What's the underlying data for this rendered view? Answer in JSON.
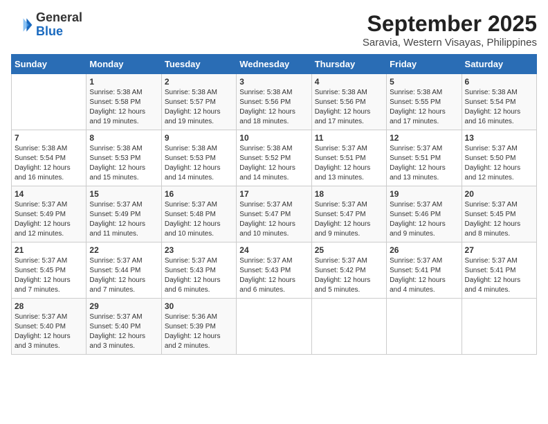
{
  "logo": {
    "general": "General",
    "blue": "Blue"
  },
  "header": {
    "month_year": "September 2025",
    "location": "Saravia, Western Visayas, Philippines"
  },
  "days_of_week": [
    "Sunday",
    "Monday",
    "Tuesday",
    "Wednesday",
    "Thursday",
    "Friday",
    "Saturday"
  ],
  "weeks": [
    [
      {
        "day": "",
        "info": ""
      },
      {
        "day": "1",
        "info": "Sunrise: 5:38 AM\nSunset: 5:58 PM\nDaylight: 12 hours\nand 19 minutes."
      },
      {
        "day": "2",
        "info": "Sunrise: 5:38 AM\nSunset: 5:57 PM\nDaylight: 12 hours\nand 19 minutes."
      },
      {
        "day": "3",
        "info": "Sunrise: 5:38 AM\nSunset: 5:56 PM\nDaylight: 12 hours\nand 18 minutes."
      },
      {
        "day": "4",
        "info": "Sunrise: 5:38 AM\nSunset: 5:56 PM\nDaylight: 12 hours\nand 17 minutes."
      },
      {
        "day": "5",
        "info": "Sunrise: 5:38 AM\nSunset: 5:55 PM\nDaylight: 12 hours\nand 17 minutes."
      },
      {
        "day": "6",
        "info": "Sunrise: 5:38 AM\nSunset: 5:54 PM\nDaylight: 12 hours\nand 16 minutes."
      }
    ],
    [
      {
        "day": "7",
        "info": "Sunrise: 5:38 AM\nSunset: 5:54 PM\nDaylight: 12 hours\nand 16 minutes."
      },
      {
        "day": "8",
        "info": "Sunrise: 5:38 AM\nSunset: 5:53 PM\nDaylight: 12 hours\nand 15 minutes."
      },
      {
        "day": "9",
        "info": "Sunrise: 5:38 AM\nSunset: 5:53 PM\nDaylight: 12 hours\nand 14 minutes."
      },
      {
        "day": "10",
        "info": "Sunrise: 5:38 AM\nSunset: 5:52 PM\nDaylight: 12 hours\nand 14 minutes."
      },
      {
        "day": "11",
        "info": "Sunrise: 5:37 AM\nSunset: 5:51 PM\nDaylight: 12 hours\nand 13 minutes."
      },
      {
        "day": "12",
        "info": "Sunrise: 5:37 AM\nSunset: 5:51 PM\nDaylight: 12 hours\nand 13 minutes."
      },
      {
        "day": "13",
        "info": "Sunrise: 5:37 AM\nSunset: 5:50 PM\nDaylight: 12 hours\nand 12 minutes."
      }
    ],
    [
      {
        "day": "14",
        "info": "Sunrise: 5:37 AM\nSunset: 5:49 PM\nDaylight: 12 hours\nand 12 minutes."
      },
      {
        "day": "15",
        "info": "Sunrise: 5:37 AM\nSunset: 5:49 PM\nDaylight: 12 hours\nand 11 minutes."
      },
      {
        "day": "16",
        "info": "Sunrise: 5:37 AM\nSunset: 5:48 PM\nDaylight: 12 hours\nand 10 minutes."
      },
      {
        "day": "17",
        "info": "Sunrise: 5:37 AM\nSunset: 5:47 PM\nDaylight: 12 hours\nand 10 minutes."
      },
      {
        "day": "18",
        "info": "Sunrise: 5:37 AM\nSunset: 5:47 PM\nDaylight: 12 hours\nand 9 minutes."
      },
      {
        "day": "19",
        "info": "Sunrise: 5:37 AM\nSunset: 5:46 PM\nDaylight: 12 hours\nand 9 minutes."
      },
      {
        "day": "20",
        "info": "Sunrise: 5:37 AM\nSunset: 5:45 PM\nDaylight: 12 hours\nand 8 minutes."
      }
    ],
    [
      {
        "day": "21",
        "info": "Sunrise: 5:37 AM\nSunset: 5:45 PM\nDaylight: 12 hours\nand 7 minutes."
      },
      {
        "day": "22",
        "info": "Sunrise: 5:37 AM\nSunset: 5:44 PM\nDaylight: 12 hours\nand 7 minutes."
      },
      {
        "day": "23",
        "info": "Sunrise: 5:37 AM\nSunset: 5:43 PM\nDaylight: 12 hours\nand 6 minutes."
      },
      {
        "day": "24",
        "info": "Sunrise: 5:37 AM\nSunset: 5:43 PM\nDaylight: 12 hours\nand 6 minutes."
      },
      {
        "day": "25",
        "info": "Sunrise: 5:37 AM\nSunset: 5:42 PM\nDaylight: 12 hours\nand 5 minutes."
      },
      {
        "day": "26",
        "info": "Sunrise: 5:37 AM\nSunset: 5:41 PM\nDaylight: 12 hours\nand 4 minutes."
      },
      {
        "day": "27",
        "info": "Sunrise: 5:37 AM\nSunset: 5:41 PM\nDaylight: 12 hours\nand 4 minutes."
      }
    ],
    [
      {
        "day": "28",
        "info": "Sunrise: 5:37 AM\nSunset: 5:40 PM\nDaylight: 12 hours\nand 3 minutes."
      },
      {
        "day": "29",
        "info": "Sunrise: 5:37 AM\nSunset: 5:40 PM\nDaylight: 12 hours\nand 3 minutes."
      },
      {
        "day": "30",
        "info": "Sunrise: 5:36 AM\nSunset: 5:39 PM\nDaylight: 12 hours\nand 2 minutes."
      },
      {
        "day": "",
        "info": ""
      },
      {
        "day": "",
        "info": ""
      },
      {
        "day": "",
        "info": ""
      },
      {
        "day": "",
        "info": ""
      }
    ]
  ]
}
